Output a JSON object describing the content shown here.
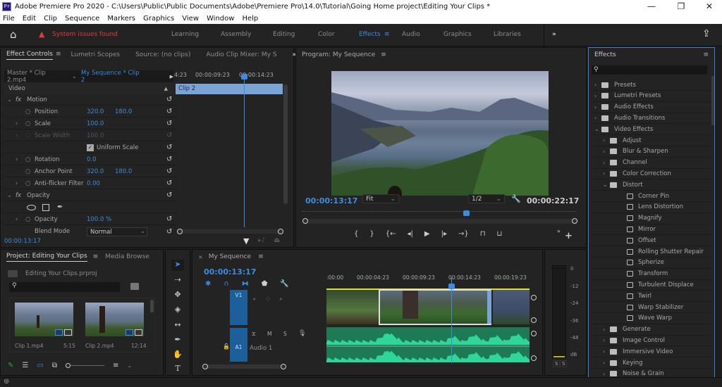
{
  "window": {
    "title": "Adobe Premiere Pro 2020 - C:\\Users\\Public\\Public Documents\\Adobe\\Premiere Pro\\14.0\\Tutorial\\Going Home project\\Editing Your Clips *",
    "app_badge": "Pr",
    "minimize": "—",
    "restore": "❐",
    "close": "✕"
  },
  "menu": [
    "File",
    "Edit",
    "Clip",
    "Sequence",
    "Markers",
    "Graphics",
    "View",
    "Window",
    "Help"
  ],
  "workspaces": {
    "home_icon": "⌂",
    "warning": "System issues found",
    "items": [
      "Learning",
      "Assembly",
      "Editing",
      "Color",
      "Effects",
      "Audio",
      "Graphics",
      "Libraries"
    ],
    "active": "Effects",
    "more": "»",
    "share_icon": "⇪"
  },
  "effect_controls": {
    "tabs": [
      "Effect Controls",
      "Lumetri Scopes",
      "Source: (no clips)",
      "Audio Clip Mixer: My S"
    ],
    "master": "Master * Clip 2.mp4",
    "sequence": "My Sequence * Clip 2",
    "section": "Video",
    "ruler": [
      "4:23",
      "00:00:09:23",
      "00:00:14:23"
    ],
    "clip_label": "Clip 2",
    "motion": "Motion",
    "opacity_group": "Opacity",
    "rows": [
      {
        "name": "Position",
        "v1": "320.0",
        "v2": "180.0"
      },
      {
        "name": "Scale",
        "v1": "100.0"
      },
      {
        "name": "Scale Width",
        "v1": "100.0"
      },
      {
        "name": "Uniform Scale"
      },
      {
        "name": "Rotation",
        "v1": "0.0"
      },
      {
        "name": "Anchor Point",
        "v1": "320.0",
        "v2": "180.0"
      },
      {
        "name": "Anti-flicker Filter",
        "v1": "0.00"
      },
      {
        "name": "Opacity",
        "v1": "100.0 %"
      },
      {
        "name": "Blend Mode",
        "v1": "Normal"
      }
    ],
    "timecode": "00:00:13:17"
  },
  "program": {
    "title": "Program: My Sequence",
    "timecode": "00:00:13:17",
    "fit": "Fit",
    "resolution": "1/2",
    "duration": "00:00:22:17",
    "playhead_fraction": 0.6,
    "buttons": [
      "{",
      "}",
      "{←",
      "◂|",
      "▶",
      "|▸",
      "→}",
      "lift",
      "extract"
    ]
  },
  "effects": {
    "title": "Effects",
    "search_placeholder": "",
    "items": [
      {
        "label": "Presets",
        "level": 0,
        "type": "folder",
        "open": false
      },
      {
        "label": "Lumetri Presets",
        "level": 0,
        "type": "folder",
        "open": false
      },
      {
        "label": "Audio Effects",
        "level": 0,
        "type": "folder",
        "open": false
      },
      {
        "label": "Audio Transitions",
        "level": 0,
        "type": "folder",
        "open": false
      },
      {
        "label": "Video Effects",
        "level": 0,
        "type": "folder",
        "open": true
      },
      {
        "label": "Adjust",
        "level": 1,
        "type": "folder",
        "open": false
      },
      {
        "label": "Blur & Sharpen",
        "level": 1,
        "type": "folder",
        "open": false
      },
      {
        "label": "Channel",
        "level": 1,
        "type": "folder",
        "open": false
      },
      {
        "label": "Color Correction",
        "level": 1,
        "type": "folder",
        "open": false
      },
      {
        "label": "Distort",
        "level": 1,
        "type": "folder",
        "open": true
      },
      {
        "label": "Corner Pin",
        "level": 2,
        "type": "effect"
      },
      {
        "label": "Lens Distortion",
        "level": 2,
        "type": "effect"
      },
      {
        "label": "Magnify",
        "level": 2,
        "type": "effect"
      },
      {
        "label": "Mirror",
        "level": 2,
        "type": "effect"
      },
      {
        "label": "Offset",
        "level": 2,
        "type": "effect"
      },
      {
        "label": "Rolling Shutter Repair",
        "level": 2,
        "type": "effect"
      },
      {
        "label": "Spherize",
        "level": 2,
        "type": "effect"
      },
      {
        "label": "Transform",
        "level": 2,
        "type": "effect"
      },
      {
        "label": "Turbulent Displace",
        "level": 2,
        "type": "effect"
      },
      {
        "label": "Twirl",
        "level": 2,
        "type": "effect"
      },
      {
        "label": "Warp Stabilizer",
        "level": 2,
        "type": "effect"
      },
      {
        "label": "Wave Warp",
        "level": 2,
        "type": "effect"
      },
      {
        "label": "Generate",
        "level": 1,
        "type": "folder",
        "open": false
      },
      {
        "label": "Image Control",
        "level": 1,
        "type": "folder",
        "open": false
      },
      {
        "label": "Immersive Video",
        "level": 1,
        "type": "folder",
        "open": false
      },
      {
        "label": "Keying",
        "level": 1,
        "type": "folder",
        "open": false
      },
      {
        "label": "Noise & Grain",
        "level": 1,
        "type": "folder",
        "open": false
      }
    ]
  },
  "project": {
    "tabs": [
      "Project: Editing Your Clips",
      "Media Browse"
    ],
    "file": "Editing Your Clips.prproj",
    "clips": [
      {
        "name": "Clip 1.mp4",
        "duration": "5:15"
      },
      {
        "name": "Clip 2.mp4",
        "duration": "12:14"
      }
    ]
  },
  "timeline": {
    "title": "My Sequence",
    "timecode": "00:00:13:17",
    "ruler": [
      ":00:00",
      "00:00:04:23",
      "00:00:09:23",
      "00:00:14:23",
      "00:00:19:23"
    ],
    "video_track": "V1",
    "audio_track": "A1",
    "audio_name": "Audio 1",
    "mute": "M",
    "solo": "S"
  },
  "meter": {
    "labels": [
      "0",
      "-12",
      "-24",
      "-36",
      "-48",
      "dB"
    ],
    "solo": [
      "S",
      "S"
    ]
  }
}
